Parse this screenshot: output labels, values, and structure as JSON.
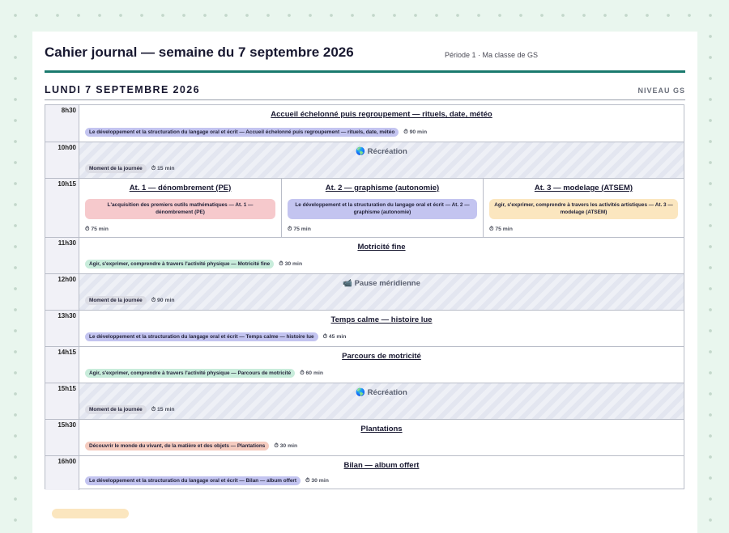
{
  "journal": {
    "title": "Cahier journal — semaine du 7 septembre 2026",
    "period": "Période 1 · Ma classe de GS"
  },
  "day": {
    "title": "LUNDI 7 SEPTEMBRE 2026",
    "level": "NIVEAU GS"
  },
  "colors": {
    "accent": "#1a7a6e",
    "tag_langage": "#c3c4f0",
    "tag_math": "#f6c9cc",
    "tag_art": "#fbe6bf",
    "tag_physique": "#c8ecdb",
    "tag_monde": "#f5cbbf",
    "tag_neutral": "#dcdde5"
  },
  "rows": [
    {
      "time": "8h30",
      "title": "Accueil échelonné puis regroupement — rituels, date, météo",
      "tag": "Le développement et la structuration du langage oral et écrit — Accueil échelonné puis regroupement — rituels, date, météo",
      "duration": "90 min"
    },
    {
      "time": "10h00",
      "break_icon": "globe-icon",
      "title": "🌎 Récréation",
      "tag": "Moment de la journée",
      "duration": "15 min"
    },
    {
      "time": "10h15",
      "workshops": [
        {
          "title": "At. 1 — dénombrement (PE)",
          "tag": "L'acquisition des premiers outils mathématiques — At. 1 — dénombrement (PE)",
          "duration": "75 min"
        },
        {
          "title": "At. 2 — graphisme (autonomie)",
          "tag": "Le développement et la structuration du langage oral et écrit — At. 2 — graphisme (autonomie)",
          "duration": "75 min"
        },
        {
          "title": "At. 3 — modelage (ATSEM)",
          "tag": "Agir, s'exprimer, comprendre à travers les activités artistiques — At. 3 — modelage (ATSEM)",
          "duration": "75 min"
        }
      ]
    },
    {
      "time": "11h30",
      "title": "Motricité fine",
      "tag": "Agir, s'exprimer, comprendre à travers l'activité physique — Motricité fine",
      "duration": "30 min"
    },
    {
      "time": "12h00",
      "break_icon": "camera-icon",
      "title": "📹 Pause méridienne",
      "tag": "Moment de la journée",
      "duration": "90 min"
    },
    {
      "time": "13h30",
      "title": "Temps calme — histoire lue",
      "tag": "Le développement et la structuration du langage oral et écrit — Temps calme — histoire lue",
      "duration": "45 min"
    },
    {
      "time": "14h15",
      "title": "Parcours de motricité",
      "tag": "Agir, s'exprimer, comprendre à travers l'activité physique — Parcours de motricité",
      "duration": "60 min"
    },
    {
      "time": "15h15",
      "break_icon": "globe-icon",
      "title": "🌎 Récréation",
      "tag": "Moment de la journée",
      "duration": "15 min"
    },
    {
      "time": "15h30",
      "title": "Plantations",
      "tag": "Découvrir le monde du vivant, de la matière et des objets — Plantations",
      "duration": "30 min"
    },
    {
      "time": "16h00",
      "title": "Bilan — album offert",
      "tag": "Le développement et la structuration du langage oral et écrit — Bilan — album offert",
      "duration": "30 min"
    }
  ]
}
